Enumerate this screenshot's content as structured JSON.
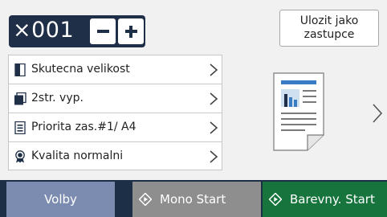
{
  "copies": {
    "value": "×001",
    "minus_icon": "minus-icon",
    "plus_icon": "plus-icon"
  },
  "save_shortcut": {
    "line1": "Ulozit jako",
    "line2": "zastupce"
  },
  "settings": [
    {
      "label": "Skutecna velikost",
      "icon": "page-size-icon"
    },
    {
      "label": "2str. vyp.",
      "icon": "duplex-icon"
    },
    {
      "label": "Priorita zas.#1/ A4",
      "icon": "tray-icon"
    },
    {
      "label": "Kvalita normalni",
      "icon": "quality-icon"
    }
  ],
  "bottom": {
    "options": "Volby",
    "mono_start": "Mono Start",
    "color_start": "Barevny. Start"
  },
  "colors": {
    "dark_navy": "#1f2f48",
    "accent_blue": "#3a7cc4",
    "green": "#16743c",
    "gray": "#8e8e8e",
    "options_blue": "#7c8cb0"
  }
}
